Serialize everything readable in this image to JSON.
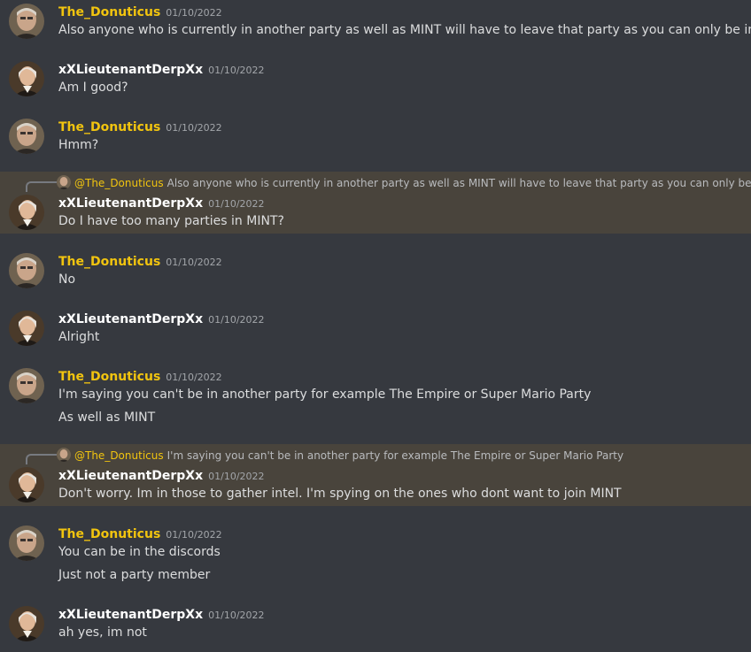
{
  "users": {
    "donuticus": {
      "name": "The_Donuticus",
      "color": "#f1c40f",
      "avatar_icon": "elderly-man-avatar-icon"
    },
    "derp": {
      "name": "xXLieutenantDerpXx",
      "color": "#ffffff",
      "avatar_icon": "hamilton-portrait-avatar-icon"
    }
  },
  "messages": [
    {
      "author": "The_Donuticus",
      "timestamp": "01/10/2022",
      "lines": [
        "Also anyone who is currently in another party as well as MINT will have to leave that party as you can only be in one"
      ]
    },
    {
      "author": "xXLieutenantDerpXx",
      "timestamp": "01/10/2022",
      "lines": [
        "Am I good?"
      ]
    },
    {
      "author": "The_Donuticus",
      "timestamp": "01/10/2022",
      "lines": [
        "Hmm?"
      ]
    },
    {
      "author": "xXLieutenantDerpXx",
      "timestamp": "01/10/2022",
      "reply": {
        "author": "@The_Donuticus",
        "text": "Also anyone who is currently in another party as well as MINT will have to leave that party as you can only be in one"
      },
      "lines": [
        "Do I have too many parties in MINT?"
      ]
    },
    {
      "author": "The_Donuticus",
      "timestamp": "01/10/2022",
      "lines": [
        "No"
      ]
    },
    {
      "author": "xXLieutenantDerpXx",
      "timestamp": "01/10/2022",
      "lines": [
        "Alright"
      ]
    },
    {
      "author": "The_Donuticus",
      "timestamp": "01/10/2022",
      "lines": [
        "I'm saying you can't be in another party for example The Empire or Super Mario Party",
        "As well as MINT"
      ]
    },
    {
      "author": "xXLieutenantDerpXx",
      "timestamp": "01/10/2022",
      "reply": {
        "author": "@The_Donuticus",
        "text": "I'm saying you can't be in another party for example The Empire or Super Mario Party"
      },
      "lines": [
        "Don't worry. Im in those to gather intel. I'm spying on the ones who dont want to join MINT"
      ]
    },
    {
      "author": "The_Donuticus",
      "timestamp": "01/10/2022",
      "lines": [
        "You can be in the discords",
        "Just not a party member"
      ]
    },
    {
      "author": "xXLieutenantDerpXx",
      "timestamp": "01/10/2022",
      "lines": [
        "ah yes, im not"
      ]
    }
  ]
}
